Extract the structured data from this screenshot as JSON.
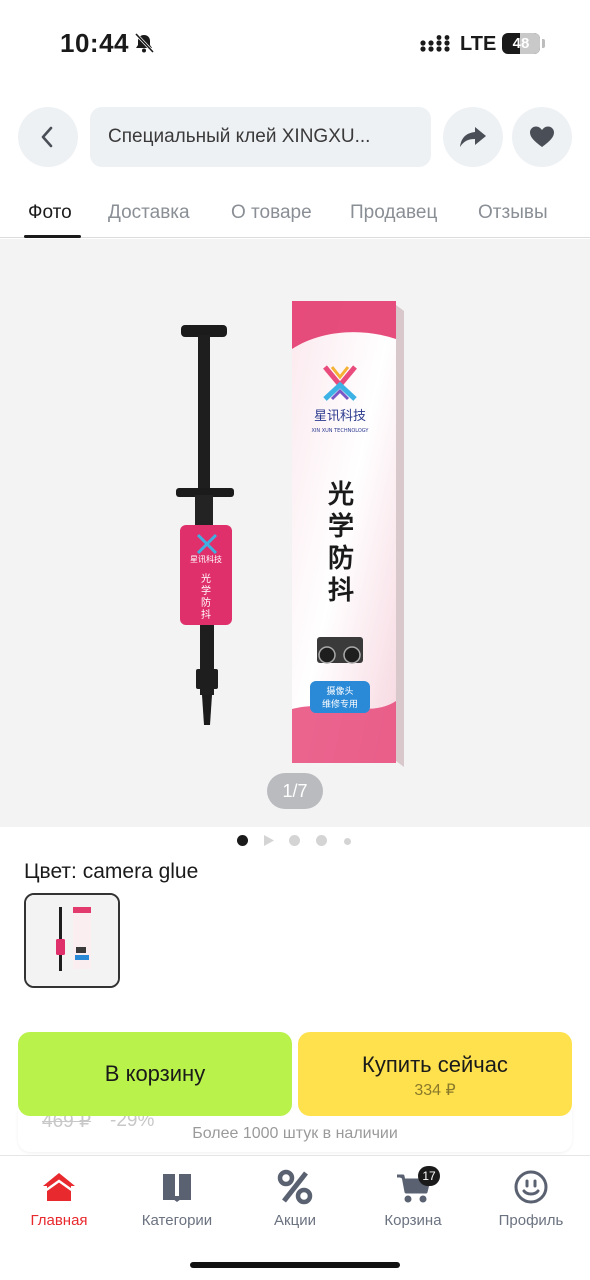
{
  "status_bar": {
    "time": "10:44",
    "network": "LTE",
    "battery": "48"
  },
  "header": {
    "search_text": "Специальный клей XINGXU..."
  },
  "tabs": [
    {
      "label": "Фото",
      "active": true
    },
    {
      "label": "Доставка",
      "active": false
    },
    {
      "label": "О товаре",
      "active": false
    },
    {
      "label": "Продавец",
      "active": false
    },
    {
      "label": "Отзывы",
      "active": false
    }
  ],
  "gallery": {
    "counter": "1/7",
    "box_brand": "星讯科技",
    "box_brand_sub": "XIN XUN TECHNOLOGY",
    "box_title": [
      "光",
      "学",
      "防",
      "抖"
    ],
    "box_tag": [
      "摄像头",
      "维修专用"
    ],
    "syringe_label": [
      "光",
      "学",
      "防",
      "抖"
    ],
    "syringe_brand": "星讯科技"
  },
  "product": {
    "color_label": "Цвет: camera glue"
  },
  "buy": {
    "cart_label": "В корзину",
    "buy_now_label": "Купить сейчас",
    "price": "334 ₽",
    "old_price": "469 ₽",
    "discount": "-29%",
    "stock": "Более 1000 штук в наличии"
  },
  "bottom_nav": [
    {
      "label": "Главная",
      "icon": "home-icon",
      "active": true
    },
    {
      "label": "Категории",
      "icon": "catalog-icon",
      "active": false
    },
    {
      "label": "Акции",
      "icon": "percent-icon",
      "active": false
    },
    {
      "label": "Корзина",
      "icon": "cart-icon",
      "active": false,
      "badge": "17"
    },
    {
      "label": "Профиль",
      "icon": "profile-icon",
      "active": false
    }
  ],
  "colors": {
    "accent_red": "#e8292e",
    "cart_green": "#b8f24a",
    "buy_yellow": "#ffe14d"
  }
}
